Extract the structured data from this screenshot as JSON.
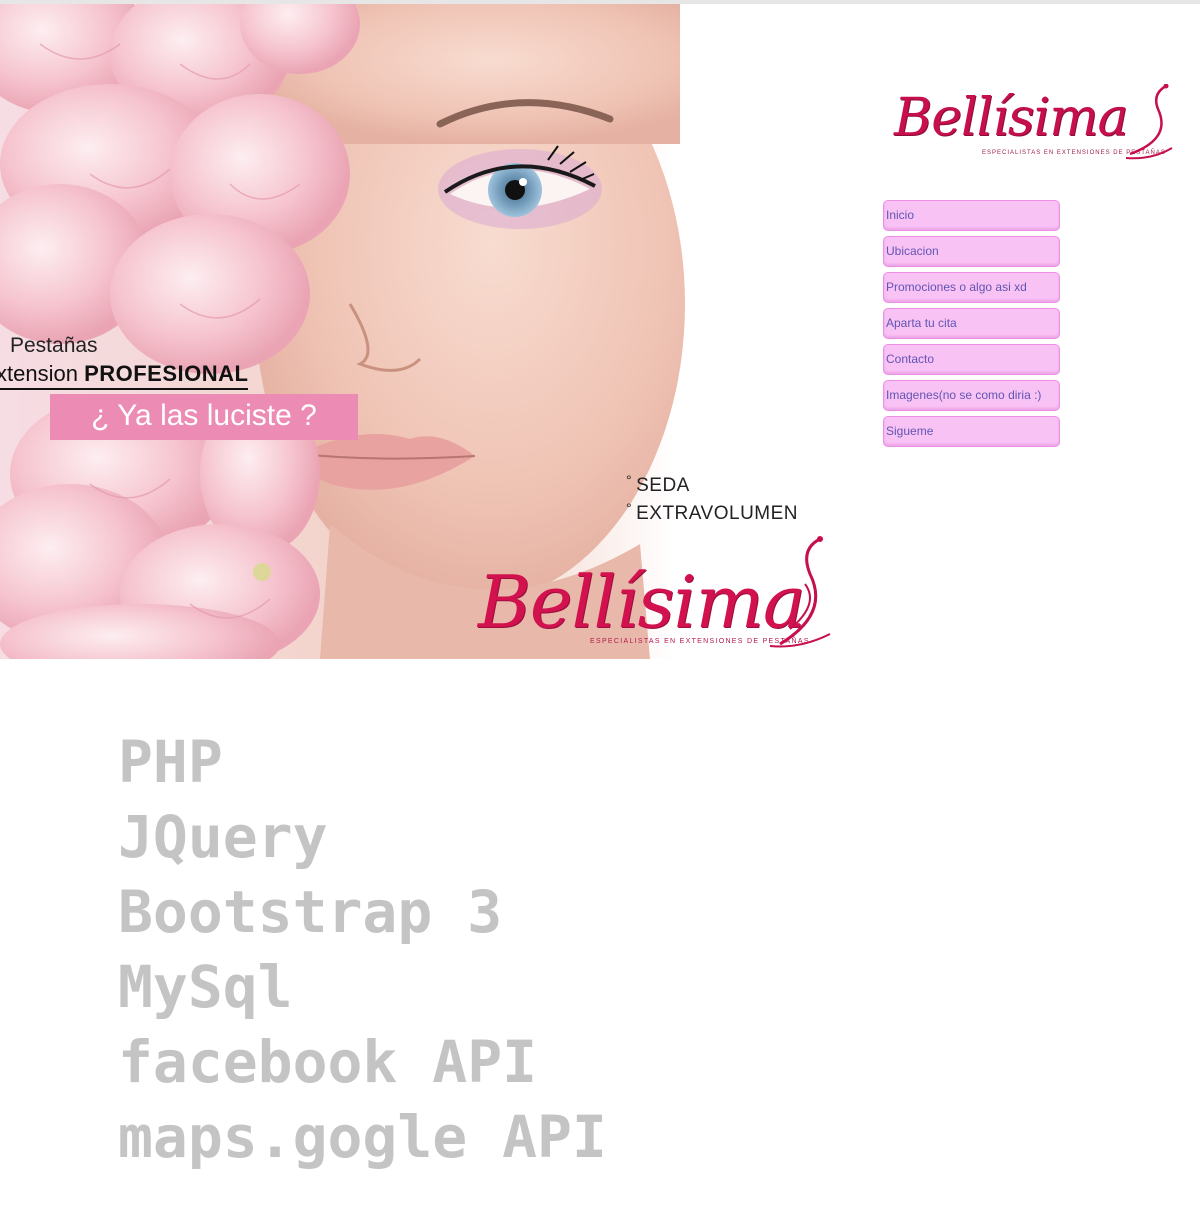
{
  "hero": {
    "line1": "Pestañas",
    "line2_prefix": "xtension ",
    "line2_bold": "PROFESIONAL",
    "callout": "¿ Ya las luciste ?",
    "bullets": [
      "SEDA",
      "EXTRAVOLUMEN"
    ],
    "bullet_glyph": "°",
    "logo_text": "Bellísima",
    "logo_tagline": "ESPECIALISTAS EN EXTENSIONES DE PESTAÑAS"
  },
  "brand": {
    "logo_text": "Bellísima",
    "tagline": "ESPECIALISTAS EN EXTENSIONES DE PESTAÑAS",
    "color": "#c70f4e"
  },
  "nav": {
    "items": [
      {
        "label": "Inicio"
      },
      {
        "label": "Ubicacion"
      },
      {
        "label": "Promociones o algo asi xd"
      },
      {
        "label": "Aparta tu cita"
      },
      {
        "label": "Contacto"
      },
      {
        "label": "Imagenes(no se como diria :)"
      },
      {
        "label": "Sigueme"
      }
    ],
    "bg_color": "#f9c2f5",
    "text_color": "#6155b2"
  },
  "stack": {
    "items": [
      "PHP",
      "JQuery",
      "Bootstrap 3",
      "MySql",
      "facebook API",
      "maps.gogle API"
    ],
    "color": "#c4c4c4"
  }
}
